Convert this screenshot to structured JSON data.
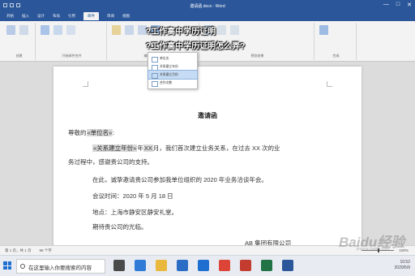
{
  "window": {
    "title": "邀请函.docx - Word",
    "controls": [
      "—",
      "□",
      "✕"
    ]
  },
  "ribbon": {
    "tabs": [
      {
        "label": "开始"
      },
      {
        "label": "插入"
      },
      {
        "label": "设计"
      },
      {
        "label": "布局"
      },
      {
        "label": "引用"
      },
      {
        "label": "邮件"
      },
      {
        "label": "审阅"
      },
      {
        "label": "视图"
      }
    ],
    "active_tab": "邮件",
    "groups": [
      {
        "label": "创建"
      },
      {
        "label": "开始邮件合并"
      },
      {
        "label": "编写和插入域"
      },
      {
        "label": "预览结果"
      },
      {
        "label": "完成"
      }
    ]
  },
  "merge_menu": {
    "items": [
      {
        "label": "单位名"
      },
      {
        "label": "关系建立年份"
      },
      {
        "label": "关系建立月份"
      },
      {
        "label": "合作次数"
      }
    ],
    "highlighted_index": 2
  },
  "overlay": {
    "line1": "?工作高中学历证明",
    "line2": "?工作高中学历证明怎么弄?"
  },
  "document": {
    "title": "邀请函",
    "greeting_prefix": "尊敬的",
    "greeting_field": "«单位名»",
    "greeting_suffix": ":",
    "p1_field1": "«关系建立年份»",
    "p1_text1": "年",
    "p1_field2": "XX",
    "p1_text2": "月，我们首次建立业务关系，在过去 XX 次的业",
    "p1_line2": "务过程中，感谢贵公司的支持。",
    "p2": "在此，诚挚邀请贵公司参加我单位组织的 2020 年业务洽谈年会。",
    "meeting_time": "会议时间：2020 年 5 月 18 日",
    "location": "地点：上海市静安区静安礼堂。",
    "closing": "期待贵公司的光临。",
    "signature": "AB 集团有限公司"
  },
  "status_bar": {
    "page": "第 1 页，共 1 页",
    "words": "98 个字",
    "zoom": "100%"
  },
  "taskbar": {
    "search_placeholder": "在这里输入你要搜索的内容",
    "apps": [
      {
        "name": "task-view-icon",
        "color": "#4a4a4a"
      },
      {
        "name": "edge-icon",
        "color": "#2f7bd6"
      },
      {
        "name": "explorer-icon",
        "color": "#e9b83c"
      },
      {
        "name": "store-icon",
        "color": "#2b6cc4"
      },
      {
        "name": "mail-icon",
        "color": "#1f6fd0"
      },
      {
        "name": "chrome-icon",
        "color": "#db4437"
      },
      {
        "name": "wps-icon",
        "color": "#c43b2f"
      },
      {
        "name": "excel-icon",
        "color": "#217346"
      },
      {
        "name": "word-icon",
        "color": "#2b579a"
      }
    ],
    "time": "10:52",
    "date": "2020/5/9"
  },
  "watermark": {
    "text": "Baidu经验",
    "sub": "jingyan.baidu.com"
  },
  "colors": {
    "accent": "#2b579a",
    "field_bg": "#d8d8d8",
    "menu_highlight": "#c5dcf4"
  }
}
